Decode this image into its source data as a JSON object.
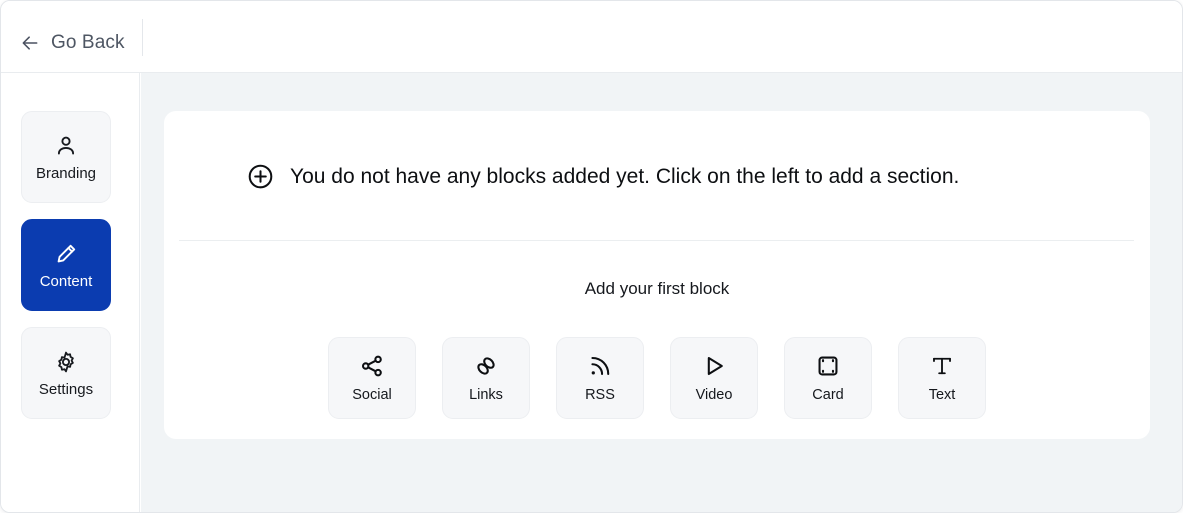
{
  "header": {
    "back_label": "Go Back",
    "back_icon": "arrow-left-icon"
  },
  "sidebar": {
    "items": [
      {
        "id": "branding",
        "label": "Branding",
        "icon": "person-icon",
        "active": false
      },
      {
        "id": "content",
        "label": "Content",
        "icon": "pencil-icon",
        "active": true
      },
      {
        "id": "settings",
        "label": "Settings",
        "icon": "gear-icon",
        "active": false
      }
    ]
  },
  "main": {
    "empty_state": {
      "icon": "plus-circle-icon",
      "message": "You do not have any blocks added yet. Click on the left to add a section."
    },
    "first_block_title": "Add your first block",
    "blocks": [
      {
        "id": "social",
        "label": "Social",
        "icon": "share-nodes-icon"
      },
      {
        "id": "links",
        "label": "Links",
        "icon": "chain-link-icon"
      },
      {
        "id": "rss",
        "label": "RSS",
        "icon": "rss-feed-icon"
      },
      {
        "id": "video",
        "label": "Video",
        "icon": "play-triangle-icon"
      },
      {
        "id": "card",
        "label": "Card",
        "icon": "card-square-icon"
      },
      {
        "id": "text",
        "label": "Text",
        "icon": "text-t-icon"
      }
    ]
  },
  "colors": {
    "accent": "#0b3cb0",
    "canvas": "#f1f4f6",
    "surface": "#ffffff",
    "muted_surface": "#f6f7f9",
    "text": "#0d0f12",
    "muted_text": "#4e5663",
    "border": "#e9ecef"
  }
}
